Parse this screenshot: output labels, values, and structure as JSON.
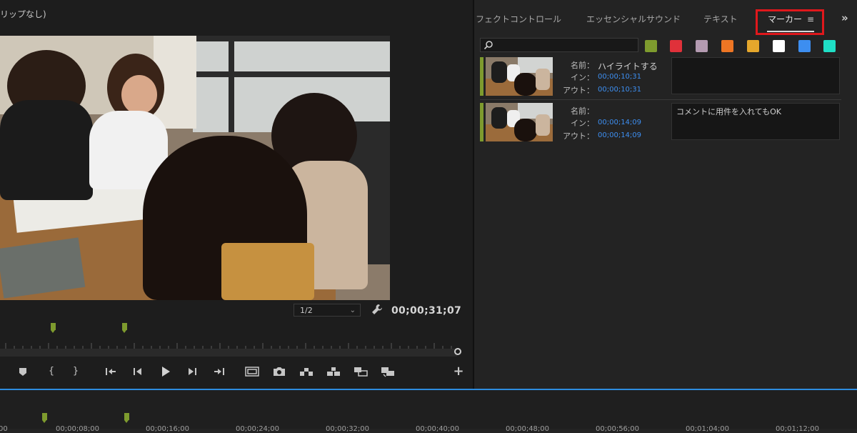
{
  "monitor": {
    "title": "リップなし)",
    "zoom": "1/2",
    "timecode": "00;00;31;07"
  },
  "panel": {
    "tabs": [
      "フェクトコントロール",
      "エッセンシャルサウンド",
      "テキスト",
      "マーカー"
    ],
    "active_tab": "マーカー",
    "tab_menu_icon": "hamburger-icon",
    "overflow_icon": "double-chevron-right-icon",
    "search": {
      "value": "",
      "placeholder": ""
    },
    "swatches": [
      "#7e9b2e",
      "#e0313a",
      "#b49bb1",
      "#ee7624",
      "#e5a72c",
      "#ffffff",
      "#3d8ef0",
      "#1fdfc6"
    ],
    "labels": {
      "name": "名前：",
      "in": "イン：",
      "out": "アウト："
    },
    "markers": [
      {
        "name": "ハイライトする",
        "in": "00;00;10;31",
        "out": "00;00;10;31",
        "comment": ""
      },
      {
        "name": "",
        "in": "00;00;14;09",
        "out": "00;00;14;09",
        "comment": "コメントに用件を入れてもOK"
      }
    ]
  },
  "colors": {
    "marker": "#7e9b2e",
    "highlight_box": "#e0181c",
    "timecode_link": "#3d8ef0",
    "timeline_accent": "#2d8cdf"
  },
  "timeline": {
    "labels": [
      "00",
      "00;00;08;00",
      "00;00;16;00",
      "00;00;24;00",
      "00;00;32;00",
      "00;00;40;00",
      "00;00;48;00",
      "00;00;56;00",
      "00;01;04;00",
      "00;01;12;00"
    ]
  }
}
